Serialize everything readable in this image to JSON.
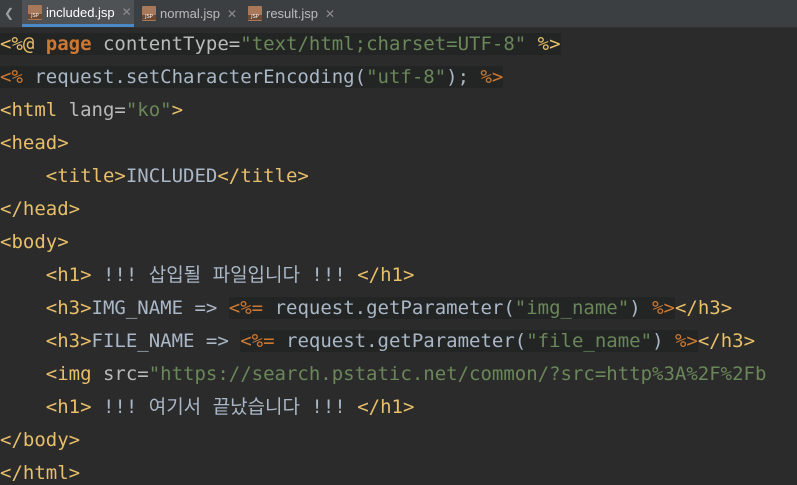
{
  "tabs": [
    {
      "label": "included.jsp",
      "active": true
    },
    {
      "label": "normal.jsp",
      "active": false
    },
    {
      "label": "result.jsp",
      "active": false
    }
  ],
  "editor": {
    "lines": [
      {
        "t1": "<%@ ",
        "t2": "page",
        "t3": " contentType=",
        "t4": "\"text/html;charset=UTF-8\"",
        "t5": " %>"
      },
      {
        "t1": "<%",
        "t2": " request.setCharacterEncoding(",
        "t3": "\"utf-8\"",
        "t4": "); ",
        "t5": "%>"
      },
      {
        "t1": "<html ",
        "t2": "lang=",
        "t3": "\"ko\"",
        "t4": ">"
      },
      {
        "t1": "<head>"
      },
      {
        "t1": "    <title>",
        "t2": "INCLUDED",
        "t3": "</title>"
      },
      {
        "t1": "</head>"
      },
      {
        "t1": "<body>"
      },
      {
        "t1": "    <h1>",
        "t2": " !!! 삽입될 파일입니다 !!! ",
        "t3": "</h1>"
      },
      {
        "t1": "    <h3>",
        "t2": "IMG_NAME => ",
        "t3": "<%=",
        "t4": " request.getParameter(",
        "t5": "\"img_name\"",
        "t6": ") ",
        "t7": "%>",
        "t8": "</h3>"
      },
      {
        "t1": "    <h3>",
        "t2": "FILE_NAME => ",
        "t3": "<%=",
        "t4": " request.getParameter(",
        "t5": "\"file_name\"",
        "t6": ") ",
        "t7": "%>",
        "t8": "</h3>"
      },
      {
        "t1": "    <img ",
        "t2": "src=",
        "t3": "\"https://search.pstatic.net/common/?src=http%3A%2F%2Fb"
      },
      {
        "t1": "    <h1>",
        "t2": " !!! 여기서 끝났습니다 !!! ",
        "t3": "</h1>"
      },
      {
        "t1": "</body>"
      },
      {
        "t1": "</html>"
      }
    ]
  },
  "colors": {
    "background": "#2b2b2b",
    "tag": "#e8bf6a",
    "string": "#6a8759",
    "keyword": "#cc7832",
    "text": "#a9b7c6"
  }
}
